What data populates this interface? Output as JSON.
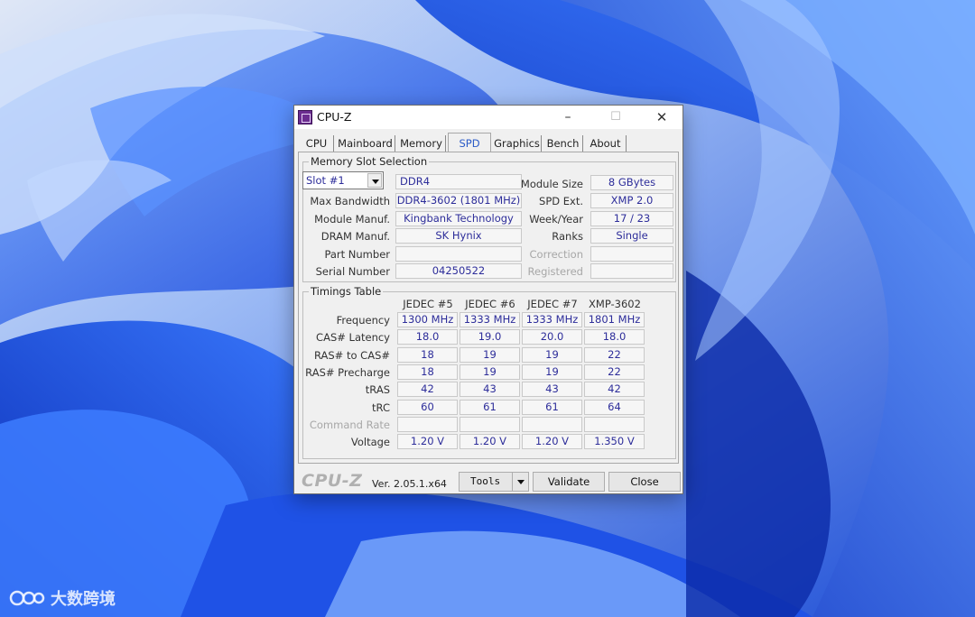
{
  "window": {
    "title": "CPU-Z",
    "controls": {
      "minimize": "–",
      "maximize": "☐",
      "close": "✕"
    }
  },
  "tabs": [
    "CPU",
    "Mainboard",
    "Memory",
    "SPD",
    "Graphics",
    "Bench",
    "About"
  ],
  "active_tab": "SPD",
  "slot_section": {
    "title": "Memory Slot Selection",
    "slot": "Slot #1",
    "memory_type": "DDR4",
    "labels": {
      "max_bandwidth": "Max Bandwidth",
      "module_manuf": "Module Manuf.",
      "dram_manuf": "DRAM Manuf.",
      "part_number": "Part Number",
      "serial_number": "Serial Number",
      "module_size": "Module Size",
      "spd_ext": "SPD Ext.",
      "week_year": "Week/Year",
      "ranks": "Ranks",
      "correction": "Correction",
      "registered": "Registered"
    },
    "values": {
      "max_bandwidth": "DDR4-3602 (1801 MHz)",
      "module_manuf": "Kingbank Technology",
      "dram_manuf": "SK Hynix",
      "part_number": "",
      "serial_number": "04250522",
      "module_size": "8 GBytes",
      "spd_ext": "XMP 2.0",
      "week_year": "17 / 23",
      "ranks": "Single",
      "correction": "",
      "registered": ""
    }
  },
  "timings": {
    "title": "Timings Table",
    "columns": [
      "JEDEC #5",
      "JEDEC #6",
      "JEDEC #7",
      "XMP-3602"
    ],
    "rows": [
      {
        "label": "Frequency",
        "values": [
          "1300 MHz",
          "1333 MHz",
          "1333 MHz",
          "1801 MHz"
        ]
      },
      {
        "label": "CAS# Latency",
        "values": [
          "18.0",
          "19.0",
          "20.0",
          "18.0"
        ]
      },
      {
        "label": "RAS# to CAS#",
        "values": [
          "18",
          "19",
          "19",
          "22"
        ]
      },
      {
        "label": "RAS# Precharge",
        "values": [
          "18",
          "19",
          "19",
          "22"
        ]
      },
      {
        "label": "tRAS",
        "values": [
          "42",
          "43",
          "43",
          "42"
        ]
      },
      {
        "label": "tRC",
        "values": [
          "60",
          "61",
          "61",
          "64"
        ]
      },
      {
        "label": "Command Rate",
        "values": [
          "",
          "",
          "",
          ""
        ],
        "dim": true
      },
      {
        "label": "Voltage",
        "values": [
          "1.20 V",
          "1.20 V",
          "1.20 V",
          "1.350 V"
        ]
      }
    ]
  },
  "footer": {
    "brand": "CPU-Z",
    "version": "Ver. 2.05.1.x64",
    "tools": "Tools",
    "validate": "Validate",
    "close": "Close"
  },
  "watermark": {
    "text": "大数跨境"
  },
  "colors": {
    "value_text": "#2d2d9a",
    "active_tab": "#2b5bc7",
    "wallpaper_dark": "#1536c8",
    "wallpaper_light": "#5d92ff"
  }
}
